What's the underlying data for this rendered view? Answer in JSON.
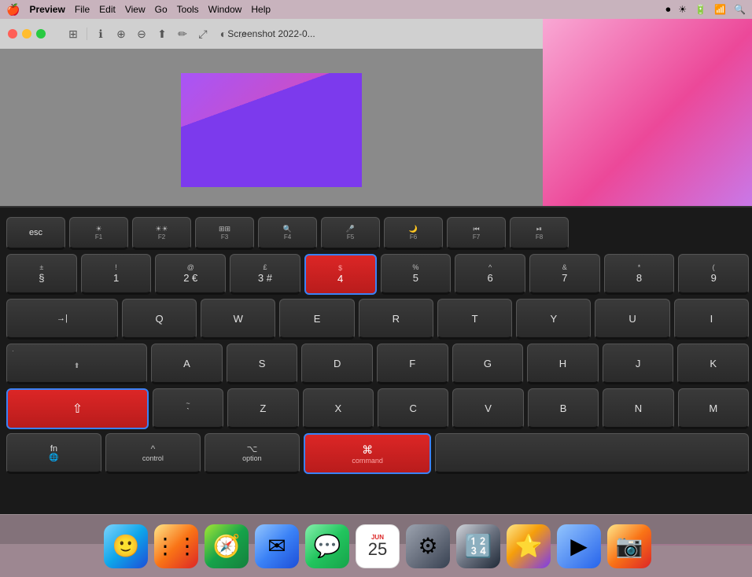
{
  "menubar": {
    "apple": "🍎",
    "app": "Preview",
    "items": [
      "File",
      "Edit",
      "View",
      "Go",
      "Tools",
      "Window",
      "Help"
    ],
    "right_icons": [
      "⏺",
      "☀",
      "🔋",
      "📶",
      "🔍"
    ]
  },
  "window": {
    "title": "Screenshot 2022-0...",
    "traffic": [
      "close",
      "minimize",
      "maximize"
    ]
  },
  "keyboard": {
    "row0": {
      "keys": [
        {
          "label": "esc",
          "top": "",
          "wide": "esc"
        },
        {
          "label": "☀",
          "sub": "F1"
        },
        {
          "label": "☀",
          "sub": "F2"
        },
        {
          "label": "⊞",
          "sub": "F3"
        },
        {
          "label": "🔍",
          "sub": "F4"
        },
        {
          "label": "🎤",
          "sub": "F5"
        },
        {
          "label": "🌙",
          "sub": "F6"
        },
        {
          "label": "⏮",
          "sub": "F7"
        },
        {
          "label": "⏯",
          "sub": "F8"
        }
      ]
    },
    "row1": {
      "keys": [
        {
          "top": "±",
          "main": "§",
          "wide": "normal"
        },
        {
          "top": "!",
          "main": "1"
        },
        {
          "top": "@",
          "main": "2",
          "sub": "€"
        },
        {
          "top": "£",
          "main": "3",
          "sub": "#"
        },
        {
          "top": "$",
          "main": "4",
          "highlight": "red"
        },
        {
          "top": "%",
          "main": "5"
        },
        {
          "top": "^",
          "main": "6"
        },
        {
          "top": "&",
          "main": "7"
        },
        {
          "top": "*",
          "main": "8"
        },
        {
          "top": "(",
          "main": "9"
        }
      ]
    },
    "row2": {
      "keys": [
        {
          "label": "→|",
          "wide": "tab"
        },
        {
          "main": "Q"
        },
        {
          "main": "W"
        },
        {
          "main": "E"
        },
        {
          "main": "R"
        },
        {
          "main": "T"
        },
        {
          "main": "Y"
        },
        {
          "main": "U"
        },
        {
          "main": "I"
        }
      ]
    },
    "row3": {
      "keys": [
        {
          "label": "caps",
          "sub": "⬆",
          "wide": "caps"
        },
        {
          "main": "A"
        },
        {
          "main": "S"
        },
        {
          "main": "D"
        },
        {
          "main": "F"
        },
        {
          "main": "G"
        },
        {
          "main": "H"
        },
        {
          "main": "J"
        },
        {
          "main": "K"
        }
      ]
    },
    "row4": {
      "keys": [
        {
          "label": "shift",
          "symbol": "⇧",
          "highlight": "red-blue"
        },
        {
          "top": "~",
          "main": "`"
        },
        {
          "main": "Z"
        },
        {
          "main": "X"
        },
        {
          "main": "C"
        },
        {
          "main": "V"
        },
        {
          "main": "B"
        },
        {
          "main": "N"
        },
        {
          "main": "M"
        }
      ]
    },
    "row5": {
      "keys": [
        {
          "label": "fn",
          "sub": "🌐"
        },
        {
          "label": "control",
          "symbol": "^"
        },
        {
          "label": "option",
          "symbol": "⌥"
        },
        {
          "label": "command",
          "symbol": "⌘",
          "highlight": "red-blue"
        }
      ]
    }
  },
  "dock": {
    "items": [
      {
        "name": "Finder",
        "type": "finder"
      },
      {
        "name": "Launchpad",
        "type": "launchpad"
      },
      {
        "name": "Safari",
        "type": "safari"
      },
      {
        "name": "Mail",
        "type": "mail"
      },
      {
        "name": "Messages",
        "type": "messages"
      },
      {
        "name": "Calendar",
        "type": "calendar",
        "month": "JUN",
        "day": "25"
      },
      {
        "name": "System Preferences",
        "type": "settings"
      },
      {
        "name": "Calculator",
        "type": "calculator"
      },
      {
        "name": "iMovie",
        "type": "imovie"
      },
      {
        "name": "QuickTime Player",
        "type": "quicktime"
      },
      {
        "name": "Preview",
        "type": "preview"
      }
    ]
  }
}
